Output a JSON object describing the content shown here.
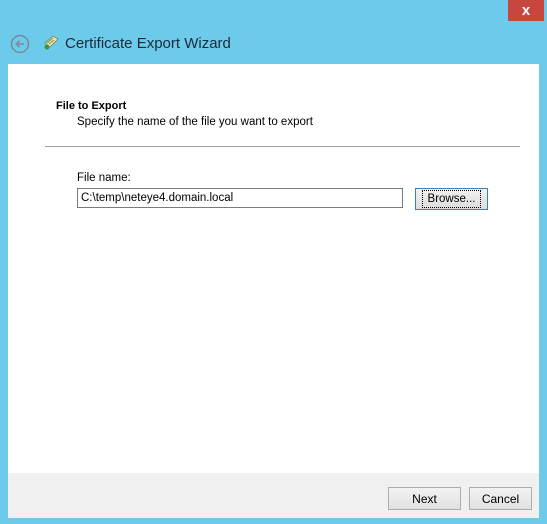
{
  "window": {
    "title": "Certificate Export Wizard",
    "close_label": "x"
  },
  "page": {
    "section_title": "File to Export",
    "section_subtitle": "Specify the name of the file you want to export"
  },
  "file": {
    "label": "File name:",
    "value": "C:\\temp\\neteye4.domain.local",
    "browse_label": "Browse..."
  },
  "footer": {
    "next_label": "Next",
    "cancel_label": "Cancel"
  },
  "icons": {
    "back": "back-arrow-icon",
    "certificate": "certificate-icon"
  }
}
